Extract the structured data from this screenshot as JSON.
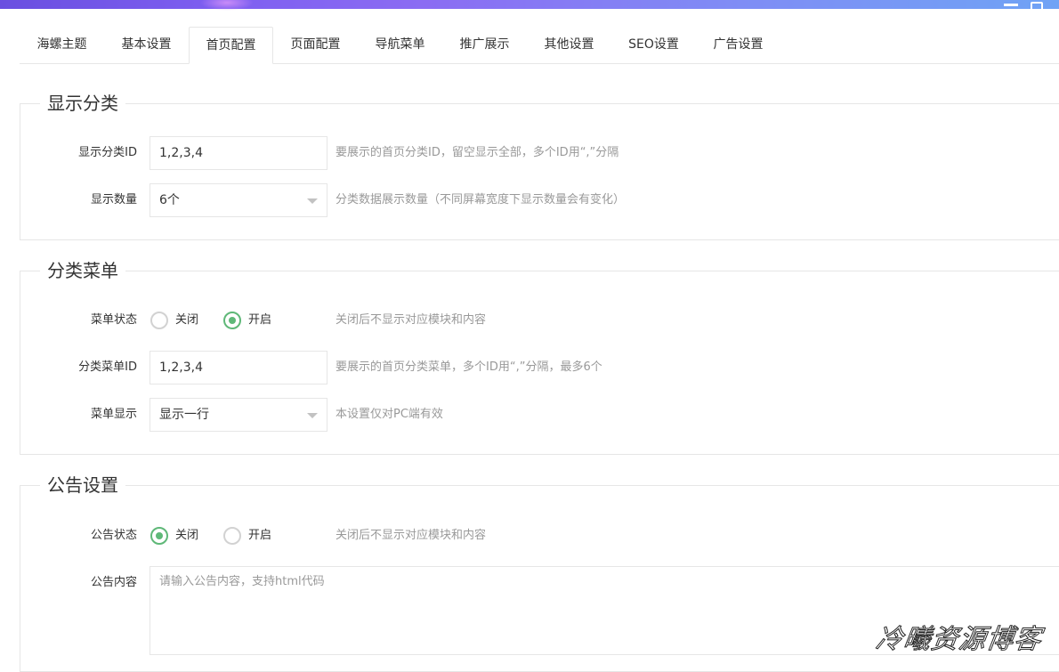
{
  "tabs": [
    {
      "label": "海螺主题"
    },
    {
      "label": "基本设置"
    },
    {
      "label": "首页配置",
      "active": true
    },
    {
      "label": "页面配置"
    },
    {
      "label": "导航菜单"
    },
    {
      "label": "推广展示"
    },
    {
      "label": "其他设置"
    },
    {
      "label": "SEO设置"
    },
    {
      "label": "广告设置"
    }
  ],
  "colors": {
    "accent": "#5FB878",
    "border": "#e6e6e6",
    "hint": "#999999"
  },
  "sections": {
    "display_category": {
      "legend": "显示分类",
      "category_id": {
        "label": "显示分类ID",
        "value": "1,2,3,4",
        "hint": "要展示的首页分类ID，留空显示全部，多个ID用“,”分隔"
      },
      "display_count": {
        "label": "显示数量",
        "value": "6个",
        "hint": "分类数据展示数量（不同屏幕宽度下显示数量会有变化）"
      }
    },
    "category_menu": {
      "legend": "分类菜单",
      "menu_status": {
        "label": "菜单状态",
        "off": "关闭",
        "on": "开启",
        "selected": "on",
        "hint": "关闭后不显示对应模块和内容"
      },
      "menu_id": {
        "label": "分类菜单ID",
        "value": "1,2,3,4",
        "hint": "要展示的首页分类菜单，多个ID用“,”分隔，最多6个"
      },
      "menu_display": {
        "label": "菜单显示",
        "value": "显示一行",
        "hint": "本设置仅对PC端有效"
      }
    },
    "notice": {
      "legend": "公告设置",
      "notice_status": {
        "label": "公告状态",
        "off": "关闭",
        "on": "开启",
        "selected": "off",
        "hint": "关闭后不显示对应模块和内容"
      },
      "notice_content": {
        "label": "公告内容",
        "placeholder": "请输入公告内容，支持html代码"
      }
    }
  },
  "watermark": "冷曦资源博客"
}
